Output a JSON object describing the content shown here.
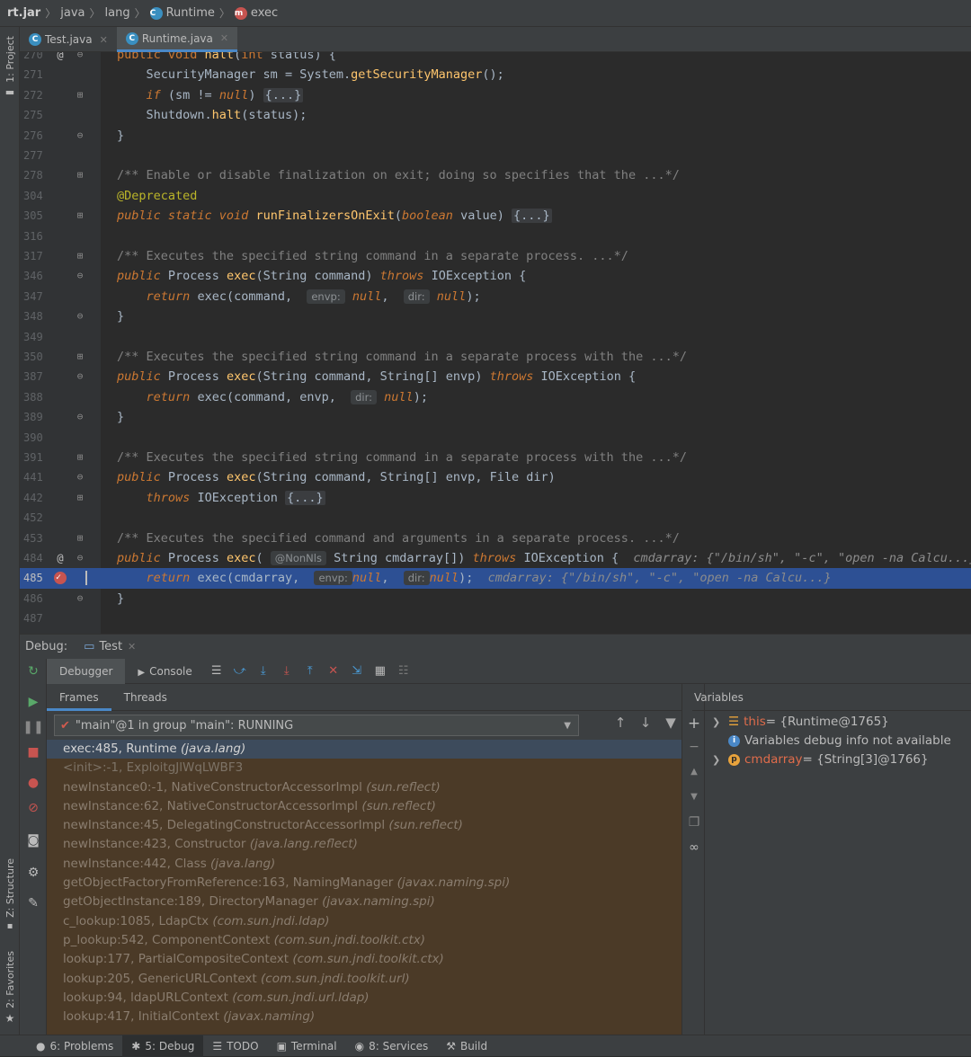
{
  "breadcrumbs": [
    "rt.jar",
    "java",
    "lang",
    "Runtime",
    "exec"
  ],
  "left_tabs": {
    "project": "1: Project",
    "structure": "Z: Structure",
    "favorites": "2: Favorites"
  },
  "editor_tabs": [
    {
      "label": "Test.java"
    },
    {
      "label": "Runtime.java"
    }
  ],
  "code_lines": [
    {
      "n": "270",
      "html": "<span class='kp'>public void</span> <span class='fn'>halt</span><span class='t'>(</span><span class='kp'>int</span> <span class='t'>status) {</span>"
    },
    {
      "n": "271",
      "html": "    <span class='t'>SecurityManager sm = System.</span><span class='fn'>getSecurityManager</span><span class='t'>();</span>"
    },
    {
      "n": "272",
      "html": "    <span class='k'>if</span> <span class='t'>(sm != </span><span class='k'>null</span><span class='t'>) </span><span class='fold-box'>{...}</span>"
    },
    {
      "n": "275",
      "html": "    <span class='t'>Shutdown.</span><span class='fn'>halt</span><span class='t'>(status);</span>"
    },
    {
      "n": "276",
      "html": "<span class='t'>}</span>"
    },
    {
      "n": "277",
      "html": ""
    },
    {
      "n": "278",
      "html": "<span class='cm'>/** Enable or disable finalization on exit; doing so specifies that the ...*/</span>"
    },
    {
      "n": "304",
      "html": "<span class='an'>@Deprecated</span>"
    },
    {
      "n": "305",
      "html": "<span class='k'>public static void</span> <span class='fn'>runFinalizersOnExit</span><span class='t'>(</span><span class='k'>boolean</span> <span class='t'>value) </span><span class='fold-box'>{...}</span>"
    },
    {
      "n": "316",
      "html": ""
    },
    {
      "n": "317",
      "html": "<span class='cm'>/** Executes the specified string command in a separate process. ...*/</span>"
    },
    {
      "n": "346",
      "html": "<span class='k'>public</span> <span class='t'>Process</span> <span class='fn'>exec</span><span class='t'>(String command) </span><span class='k'>throws</span> <span class='t'>IOException {</span>"
    },
    {
      "n": "347",
      "html": "    <span class='k'>return</span> <span class='t'>exec(command,  </span><span class='hint'>envp:</span> <span class='k'>null</span><span class='t'>,  </span><span class='hint'>dir:</span> <span class='k'>null</span><span class='t'>);</span>"
    },
    {
      "n": "348",
      "html": "<span class='t'>}</span>"
    },
    {
      "n": "349",
      "html": ""
    },
    {
      "n": "350",
      "html": "<span class='cm'>/** Executes the specified string command in a separate process with the ...*/</span>"
    },
    {
      "n": "387",
      "html": "<span class='k'>public</span> <span class='t'>Process</span> <span class='fn'>exec</span><span class='t'>(String command, String[] envp) </span><span class='k'>throws</span> <span class='t'>IOException {</span>"
    },
    {
      "n": "388",
      "html": "    <span class='k'>return</span> <span class='t'>exec(command, envp,  </span><span class='hint'>dir:</span> <span class='k'>null</span><span class='t'>);</span>"
    },
    {
      "n": "389",
      "html": "<span class='t'>}</span>"
    },
    {
      "n": "390",
      "html": ""
    },
    {
      "n": "391",
      "html": "<span class='cm'>/** Executes the specified string command in a separate process with the ...*/</span>"
    },
    {
      "n": "441",
      "html": "<span class='k'>public</span> <span class='t'>Process</span> <span class='fn'>exec</span><span class='t'>(String command, String[] envp, File dir)</span>"
    },
    {
      "n": "442",
      "html": "    <span class='k'>throws</span> <span class='t'>IOException </span><span class='fold-box'>{...}</span>"
    },
    {
      "n": "452",
      "html": ""
    },
    {
      "n": "453",
      "html": "<span class='cm'>/** Executes the specified command and arguments in a separate process. ...*/</span>"
    },
    {
      "n": "484",
      "html": "<span class='k'>public</span> <span class='t'>Process</span> <span class='fn'>exec</span><span class='t'>( </span><span class='hint'>@NonNls</span><span class='t'> String cmdarray[]) </span><span class='k'>throws</span> <span class='t'>IOException {  </span><span class='inl'>cmdarray: {\"/bin/sh\", \"-c\", \"open -na Calcu...}</span>"
    },
    {
      "n": "485",
      "html": "    <span class='k'>return</span> <span class='t'>exec(cmdarray,  </span><span class='hint'>envp:</span><span class='k'>null</span><span class='t'>,  </span><span class='hint'>dir:</span><span class='k'>null</span><span class='t'>);  </span><span class='inl'>cmdarray: {\"/bin/sh\", \"-c\", \"open -na Calcu...}</span>"
    },
    {
      "n": "486",
      "html": "<span class='t'>}</span>"
    },
    {
      "n": "487",
      "html": ""
    }
  ],
  "debug": {
    "label": "Debug:",
    "session": "Test"
  },
  "toolbar": {
    "debugger": "Debugger",
    "console": "Console"
  },
  "subtabs": {
    "frames": "Frames",
    "threads": "Threads"
  },
  "thread": "\"main\"@1 in group \"main\": RUNNING",
  "frames": [
    {
      "m": "exec:485, Runtime",
      "p": "(java.lang)"
    },
    {
      "m": "<init>:-1, ExploitgJlWqLWBF3",
      "p": ""
    },
    {
      "m": "newInstance0:-1, NativeConstructorAccessorImpl",
      "p": "(sun.reflect)"
    },
    {
      "m": "newInstance:62, NativeConstructorAccessorImpl",
      "p": "(sun.reflect)"
    },
    {
      "m": "newInstance:45, DelegatingConstructorAccessorImpl",
      "p": "(sun.reflect)"
    },
    {
      "m": "newInstance:423, Constructor",
      "p": "(java.lang.reflect)"
    },
    {
      "m": "newInstance:442, Class",
      "p": "(java.lang)"
    },
    {
      "m": "getObjectFactoryFromReference:163, NamingManager",
      "p": "(javax.naming.spi)"
    },
    {
      "m": "getObjectInstance:189, DirectoryManager",
      "p": "(javax.naming.spi)"
    },
    {
      "m": "c_lookup:1085, LdapCtx",
      "p": "(com.sun.jndi.ldap)"
    },
    {
      "m": "p_lookup:542, ComponentContext",
      "p": "(com.sun.jndi.toolkit.ctx)"
    },
    {
      "m": "lookup:177, PartialCompositeContext",
      "p": "(com.sun.jndi.toolkit.ctx)"
    },
    {
      "m": "lookup:205, GenericURLContext",
      "p": "(com.sun.jndi.toolkit.url)"
    },
    {
      "m": "lookup:94, ldapURLContext",
      "p": "(com.sun.jndi.url.ldap)"
    },
    {
      "m": "lookup:417, InitialContext",
      "p": "(javax.naming)"
    }
  ],
  "variables": {
    "header": "Variables",
    "this_name": "this",
    "this_val": " = {Runtime@1765}",
    "info": "Variables debug info not available",
    "cmd_name": "cmdarray",
    "cmd_val": " = {String[3]@1766}"
  },
  "status": [
    {
      "icon": "●",
      "label": "6: Problems"
    },
    {
      "icon": "✱",
      "label": "5: Debug"
    },
    {
      "icon": "☰",
      "label": "TODO"
    },
    {
      "icon": "▣",
      "label": "Terminal"
    },
    {
      "icon": "◉",
      "label": "8: Services"
    },
    {
      "icon": "⚒",
      "label": "Build"
    }
  ],
  "colors": {
    "accent": "#4a88c7",
    "breakpoint": "#c75450",
    "selection": "#2d5094"
  }
}
